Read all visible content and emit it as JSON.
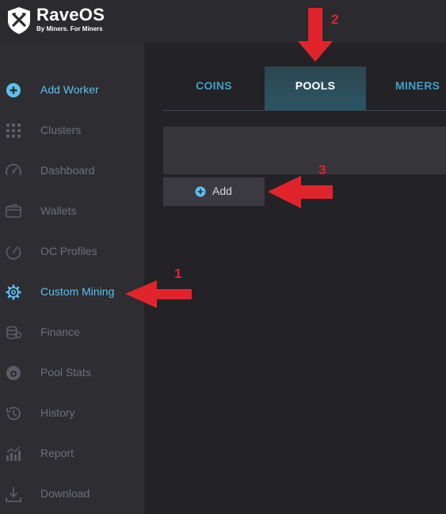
{
  "brand": {
    "name": "RaveOS",
    "tagline": "By Miners. For Miners"
  },
  "sidebar": {
    "items": [
      {
        "label": "Add Worker",
        "icon": "plus-circle-icon"
      },
      {
        "label": "Clusters",
        "icon": "grid-icon"
      },
      {
        "label": "Dashboard",
        "icon": "speedometer-icon"
      },
      {
        "label": "Wallets",
        "icon": "wallet-icon"
      },
      {
        "label": "OC Profiles",
        "icon": "gauge-icon"
      },
      {
        "label": "Custom Mining",
        "icon": "gear-icon",
        "active": true
      },
      {
        "label": "Finance",
        "icon": "coins-icon"
      },
      {
        "label": "Pool Stats",
        "icon": "pool-icon"
      },
      {
        "label": "History",
        "icon": "history-icon"
      },
      {
        "label": "Report",
        "icon": "bar-chart-icon"
      },
      {
        "label": "Download",
        "icon": "download-icon"
      }
    ]
  },
  "tabs": [
    {
      "label": "COINS"
    },
    {
      "label": "POOLS",
      "active": true
    },
    {
      "label": "MINERS"
    }
  ],
  "actions": {
    "add_label": "Add"
  },
  "annotations": {
    "step1": "1",
    "step2": "2",
    "step3": "3"
  },
  "colors": {
    "accent": "#5ac2f0",
    "tab_text": "#3fa0c4",
    "arrow": "#e1242b",
    "active_tab_bg": "#2a5564"
  }
}
